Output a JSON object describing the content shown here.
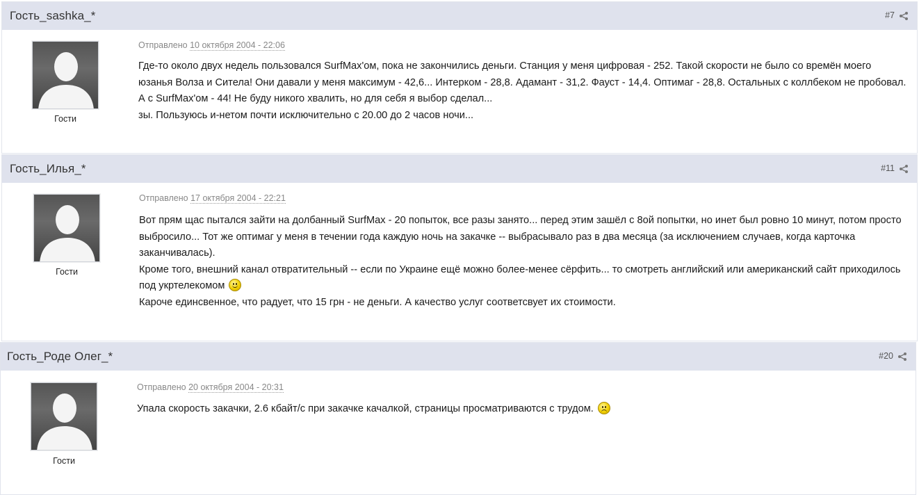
{
  "posts": [
    {
      "author": "Гость_sashka_*",
      "number": "#7",
      "group": "Гости",
      "sent_label": "Отправлено",
      "date": "10 октября 2004 - 22:06",
      "lines": [
        "Где-то около двух недель пользовался SurfMax'ом, пока не закончились деньги. Станция у меня цифровая - 252. Такой скорости не было со времён моего юзанья Волза и Ситела! Они давали у меня максимум - 42,6... Интерком - 28,8. Адамант - 31,2. Фауст - 14,4. Оптимаг - 28,8. Остальных с коллбеком не пробовал. А с SurfMax'ом - 44! Не буду никого хвалить, но для себя я выбор сделал...",
        "зы. Пользуюсь и-нетом почти исключительно с 20.00 до 2 часов ночи..."
      ]
    },
    {
      "author": "Гость_Илья_*",
      "number": "#11",
      "group": "Гости",
      "sent_label": "Отправлено",
      "date": "17 октября 2004 - 22:21",
      "lines": [
        "Вот прям щас пытался зайти на долбанный SurfMax - 20 попыток, все разы занято... перед этим зашёл с 8ой попытки, но инет был ровно 10 минут, потом просто выбросило... Тот же оптимаг у меня в течении года каждую ночь на закачке -- выбрасывало раз в два месяца (за исключением случаев, когда карточка заканчивалась).",
        "Кроме того, внешний канал отвратительный -- если по Украине ещё можно более-менее сёрфить... то смотреть английский или американский сайт приходилось под укртелекомом",
        "Кароче единсвенное, что радует, что 15 грн - не деньги. А качество услуг соответсвует их стоимости."
      ],
      "emoticon": "smile-emoticon"
    },
    {
      "author": "Гость_Роде Олег_*",
      "number": "#20",
      "group": "Гости",
      "sent_label": "Отправлено",
      "date": "20 октября 2004 - 20:31",
      "lines": [
        "Упала скорость закачки, 2.6 кбайт/с при закачке качалкой, страницы просматриваются с трудом."
      ],
      "emoticon": "sad-emoticon"
    }
  ],
  "colors": {
    "header_bg": "#dfe2ed",
    "text": "#1a1a1a",
    "meta": "#888888"
  }
}
